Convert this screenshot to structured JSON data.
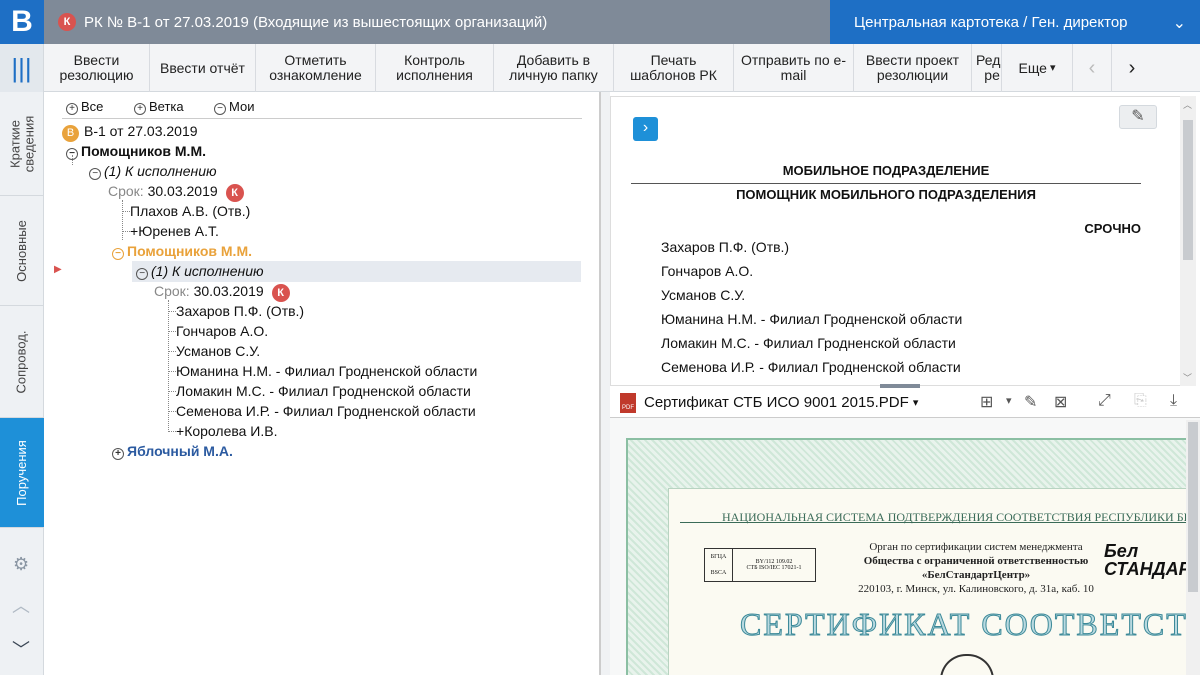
{
  "header": {
    "logo": "В",
    "badge": "К",
    "title": "РК № В-1 от 27.03.2019 (Входящие из вышестоящих организаций)",
    "context": "Центральная картотека / Ген. директор"
  },
  "sidebar": {
    "tabs": [
      "Краткие сведения",
      "Основные",
      "Сопровод.",
      "Поручения"
    ],
    "active_tab": "Поручения"
  },
  "toolbar": {
    "buttons": [
      "Ввести резолюцию",
      "Ввести отчёт",
      "Отметить ознакомление",
      "Контроль исполнения",
      "Добавить в личную папку",
      "Печать шаблонов РК",
      "Отправить по e-mail",
      "Ввести проект резолюции",
      "Реда ре",
      "Еще"
    ]
  },
  "tree": {
    "filters": [
      "Все",
      "Ветка",
      "Мои"
    ],
    "root": "В-1 от 27.03.2019",
    "root_badge": "В",
    "n1": "Помощников М.М.",
    "n2": "(1) К исполнению",
    "due_label": "Срок:",
    "due1": "30.03.2019",
    "n3": "Плахов А.В. (Отв.)",
    "n4": "Юренев А.Т.",
    "n5": "Помощников М.М.",
    "n6": "(1) К исполнению",
    "due2": "30.03.2019",
    "people": [
      "Захаров П.Ф. (Отв.)",
      "Гончаров А.О.",
      "Усманов С.У.",
      "Юманина Н.М. - Филиал Гродненской области",
      "Ломакин М.С. - Филиал Гродненской области",
      "Семенова И.Р. - Филиал Гродненской области"
    ],
    "n7": "Королева И.В.",
    "n8": "Яблочный М.А."
  },
  "document": {
    "line1": "МОБИЛЬНОЕ ПОДРАЗДЕЛЕНИЕ",
    "line2": "ПОМОЩНИК МОБИЛЬНОГО ПОДРАЗДЕЛЕНИЯ",
    "urgent": "СРОЧНО",
    "recipients": [
      "Захаров П.Ф.  (Отв.)",
      "Гончаров А.О.",
      "Усманов С.У.",
      "Юманина Н.М. - Филиал Гродненской области",
      "Ломакин М.С. - Филиал Гродненской области",
      "Семенова И.Р. - Филиал Гродненской области"
    ]
  },
  "attachment": {
    "file_name": "Сертификат СТБ ИСО 9001 2015.PDF"
  },
  "certificate": {
    "header": "НАЦИОНАЛЬНАЯ СИСТЕМА ПОДТВЕРЖДЕНИЯ СООТВЕТСТВИЯ РЕСПУБЛИКИ БЕЛАРУСЬ",
    "line1": "Орган по сертификации систем менеджмента",
    "line2": "Общества с ограниченной ответственностью",
    "line3": "«БелСтандартЦентр»",
    "line4": "220103, г. Минск, ул. Калиновского, д. 31а, каб. 10",
    "code": "BY/112 109.02",
    "std": "СТБ ISO/IEC 17021-1",
    "stamp1": "БГЦА",
    "stamp2": "BSCA",
    "logo": "Бел СТАНДАР",
    "title": "СЕРТИФИКАТ СООТВЕТСТВИЯ"
  },
  "colors": {
    "accent": "#1e6fc5",
    "highlight": "#e9a23b",
    "link": "#2b5aa0",
    "badge": "#d9534f"
  }
}
